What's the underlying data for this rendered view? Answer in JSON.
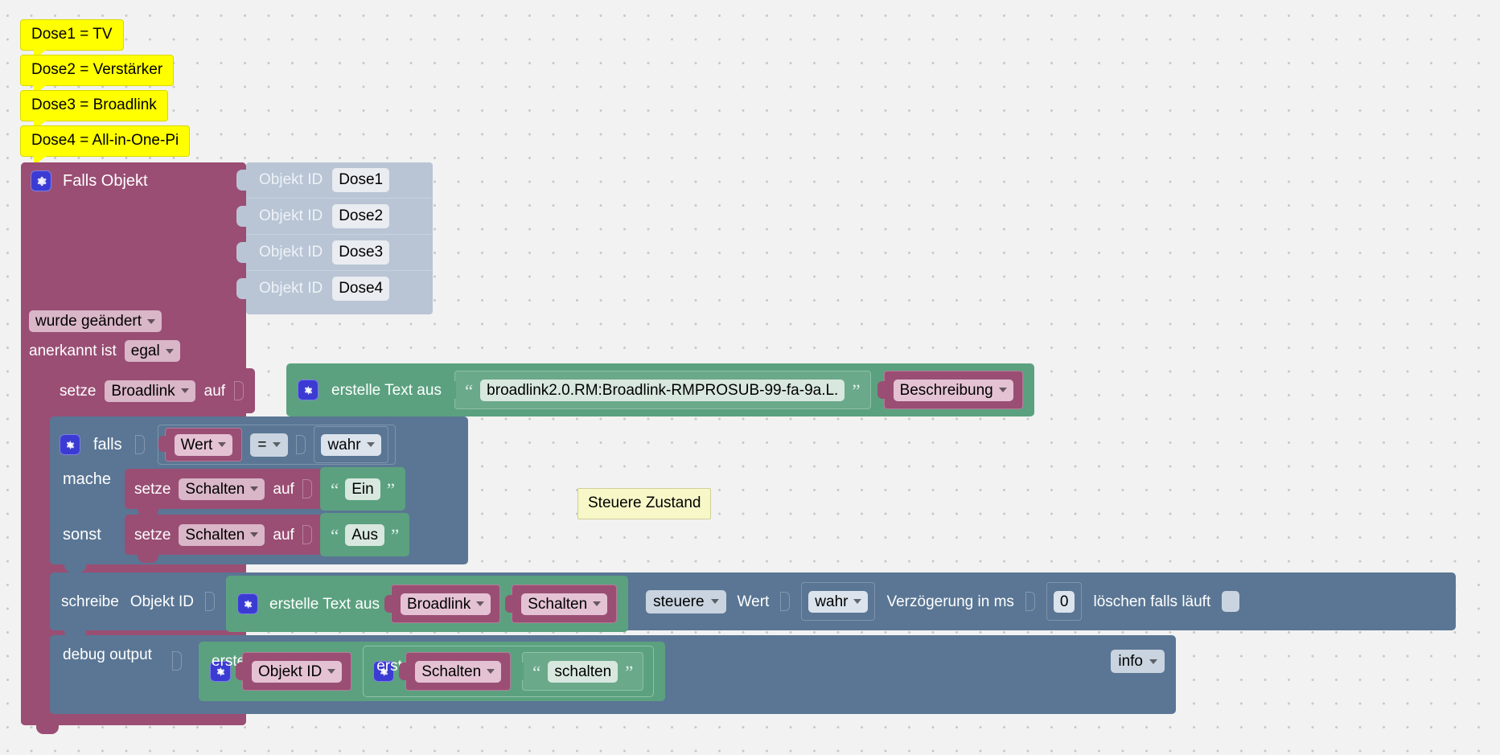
{
  "workspace": {
    "background_color": "#f2f2f2",
    "grid_dot_color": "#c9c9c9"
  },
  "colors": {
    "event_block": "#9a4e74",
    "control_block": "#5a7694",
    "text_block": "#5ba17f",
    "objid_block": "#b9c5d5",
    "comment_yellow": "#ffff00",
    "comment_note": "#f7f7c8",
    "gear_icon": "#3b3bd4"
  },
  "comments": [
    {
      "text": "Dose1 = TV"
    },
    {
      "text": "Dose2 = Verstärker"
    },
    {
      "text": "Dose3 = Broadlink"
    },
    {
      "text": "Dose4 = All-in-One-Pi"
    }
  ],
  "note": {
    "text": "Steuere Zustand"
  },
  "event_block": {
    "title": "Falls Objekt",
    "gear_icon": "gear-icon",
    "objid_rows": [
      {
        "label": "Objekt ID",
        "value": "Dose1"
      },
      {
        "label": "Objekt ID",
        "value": "Dose2"
      },
      {
        "label": "Objekt ID",
        "value": "Dose3"
      },
      {
        "label": "Objekt ID",
        "value": "Dose4"
      }
    ],
    "trigger": "wurde geändert",
    "ack_label": "anerkannt ist",
    "ack_value": "egal"
  },
  "set_broadlink": {
    "setze": "setze",
    "variable": "Broadlink",
    "auf": "auf",
    "textjoin_label": "erstelle Text aus",
    "string_value": "broadlink2.0.RM:Broadlink-RMPROSUB-99-fa-9a.L.",
    "property": "Beschreibung"
  },
  "if_block": {
    "falls": "falls",
    "left_operand": "Wert",
    "operator": "=",
    "right_operand": "wahr",
    "mache": "mache",
    "sonst": "sonst",
    "mache_statement": {
      "setze": "setze",
      "variable": "Schalten",
      "auf": "auf",
      "value": "Ein"
    },
    "sonst_statement": {
      "setze": "setze",
      "variable": "Schalten",
      "auf": "auf",
      "value": "Aus"
    }
  },
  "write_block": {
    "schreibe": "schreibe",
    "objekt_id_label": "Objekt ID",
    "textjoin_label": "erstelle Text aus",
    "var1": "Broadlink",
    "var2": "Schalten",
    "mode": "steuere",
    "wert_label": "Wert",
    "wert_value": "wahr",
    "delay_label": "Verzögerung in ms",
    "delay_value": "0",
    "clear_label": "löschen falls läuft",
    "clear_checked": false
  },
  "debug_block": {
    "debug_label": "debug output",
    "textjoin_label": "erstelle Text aus",
    "var1": "Objekt ID",
    "nested_textjoin_label": "erstelle Text aus",
    "nested_var": "Schalten",
    "nested_string": "schalten",
    "severity": "info"
  }
}
